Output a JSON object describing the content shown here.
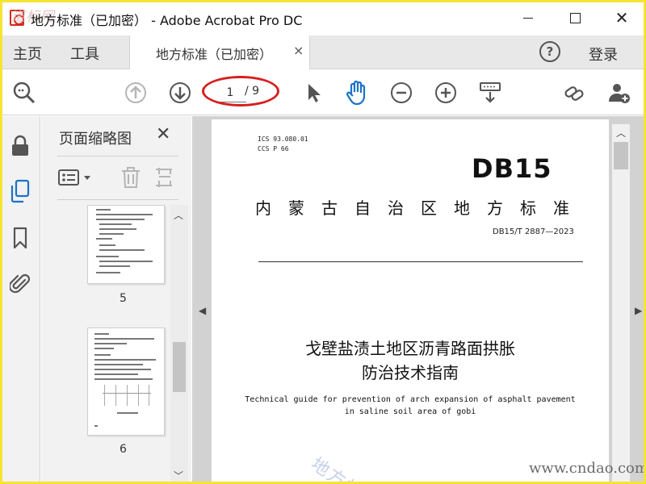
{
  "window": {
    "title": "地方标准（已加密） - Adobe Acrobat Pro DC",
    "watermark_corner": "道标网"
  },
  "nav": {
    "home": "主页",
    "tools": "工具",
    "doc_tab": "地方标准（已加密）",
    "doc_tab_close": "×",
    "help": "?",
    "login": "登录"
  },
  "toolbar": {
    "current_page": "1",
    "total_pages": "/ 9",
    "icons": [
      "zoom-search-icon",
      "page-up-icon",
      "page-down-icon",
      "select-arrow-icon",
      "hand-tool-icon",
      "zoom-out-icon",
      "zoom-in-icon",
      "keyboard-icon",
      "link-icon",
      "add-user-icon"
    ]
  },
  "sidebar": {
    "icons": [
      "lock-icon",
      "page-thumbnails-icon",
      "bookmark-icon",
      "attachment-icon"
    ]
  },
  "thumbnails": {
    "title": "页面缩略图",
    "close": "✕",
    "pages": [
      {
        "number": "5"
      },
      {
        "number": "6"
      }
    ]
  },
  "document": {
    "ics": "ICS  93.080.01",
    "ccs": "CCS  P 66",
    "code": "DB15",
    "standard_name": "内蒙古自治区地方标准",
    "standard_number": "DB15/T 2887—2023",
    "title_line1": "戈壁盐渍土地区沥青路面拱胀",
    "title_line2": "防治技术指南",
    "english_line1": "Technical guide for prevention of arch expansion of asphalt pavement",
    "english_line2": "in saline soil area of gobi",
    "watermark_diag": "地方标",
    "watermark_url": "www.cndao.com"
  },
  "colors": {
    "frame": "#f5e532",
    "annotation": "#d71f1f",
    "accent_blue": "#1a73c8",
    "gray_icon": "#555555"
  }
}
